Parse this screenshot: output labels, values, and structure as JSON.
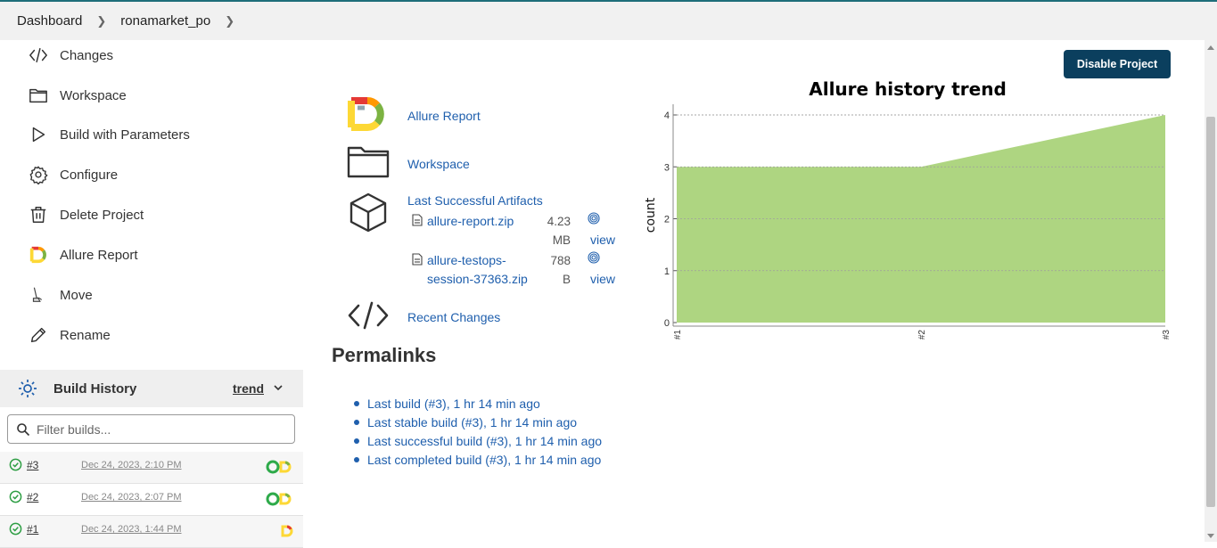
{
  "breadcrumb": {
    "items": [
      "Dashboard",
      "ronamarket_po"
    ]
  },
  "sidebar": {
    "items": [
      {
        "label": "Changes",
        "icon": "code-icon"
      },
      {
        "label": "Workspace",
        "icon": "folder-icon"
      },
      {
        "label": "Build with Parameters",
        "icon": "play-icon"
      },
      {
        "label": "Configure",
        "icon": "gear-icon"
      },
      {
        "label": "Delete Project",
        "icon": "trash-icon"
      },
      {
        "label": "Allure Report",
        "icon": "allure-icon"
      },
      {
        "label": "Move",
        "icon": "move-icon"
      },
      {
        "label": "Rename",
        "icon": "pencil-icon"
      }
    ]
  },
  "build_history": {
    "title": "Build History",
    "trend_label": "trend",
    "filter_placeholder": "Filter builds...",
    "builds": [
      {
        "number": "#3",
        "date": "Dec 24, 2023, 2:10 PM"
      },
      {
        "number": "#2",
        "date": "Dec 24, 2023, 2:07 PM"
      },
      {
        "number": "#1",
        "date": "Dec 24, 2023, 1:44 PM"
      }
    ]
  },
  "main": {
    "disable_button": "Disable Project",
    "links": {
      "allure_report": "Allure Report",
      "workspace": "Workspace",
      "last_successful_artifacts": "Last Successful Artifacts",
      "recent_changes": "Recent Changes"
    },
    "artifacts": [
      {
        "name_line1": "allure-report.zip",
        "name_line2": "",
        "size_line1": "4.23",
        "size_line2": "MB",
        "view": "view"
      },
      {
        "name_line1": "allure-testops-",
        "name_line2": "session-37363.zip",
        "size_line1": "788",
        "size_line2": "B",
        "view": "view"
      }
    ],
    "permalinks": {
      "title": "Permalinks",
      "items": [
        "Last build (#3), 1 hr 14 min ago",
        "Last stable build (#3), 1 hr 14 min ago",
        "Last successful build (#3), 1 hr 14 min ago",
        "Last completed build (#3), 1 hr 14 min ago"
      ]
    }
  },
  "chart_data": {
    "type": "area",
    "title": "Allure history trend",
    "ylabel": "count",
    "xlabel": "",
    "categories": [
      "#1",
      "#2",
      "#3"
    ],
    "values": [
      3,
      3,
      4
    ],
    "ylim": [
      0,
      4
    ],
    "yticks": [
      "0",
      "1",
      "2",
      "3",
      "4"
    ],
    "fill_color": "#aed581",
    "grid": true
  }
}
